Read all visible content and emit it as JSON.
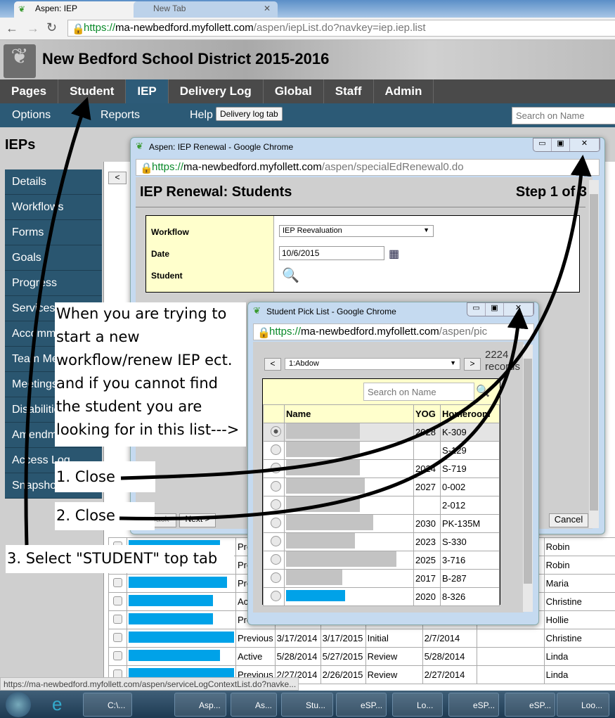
{
  "browser": {
    "tabs": [
      {
        "label": "Aspen: IEP"
      },
      {
        "label": "New Tab"
      }
    ],
    "url": {
      "scheme": "https://",
      "host": "ma-newbedford.myfollett.com",
      "path": "/aspen/iepList.do?navkey=iep.iep.list"
    },
    "status_url": "https://ma-newbedford.myfollett.com/aspen/serviceLogContextList.do?navke..."
  },
  "app": {
    "title": "New Bedford School District 2015-2016",
    "top_tabs": [
      "Pages",
      "Student",
      "IEP",
      "Delivery Log",
      "Global",
      "Staff",
      "Admin"
    ],
    "active_tab": "IEP",
    "sub_nav": [
      "Options",
      "Reports",
      "Help"
    ],
    "tooltip": "Delivery log tab",
    "search_placeholder": "Search on Name",
    "page_title": "IEPs",
    "side_items": [
      "Details",
      "Workflows",
      "Forms",
      "Goals",
      "Progress",
      "Services",
      "Accommodations",
      "Team Members",
      "Meetings",
      "Disabilities",
      "Amendments",
      "Access Log",
      "Snapshots"
    ],
    "prev_button": "<",
    "rows": [
      {
        "status": "Pre",
        "d1": "",
        "d2": "",
        "type": "",
        "d3": "",
        "staff": "Robin"
      },
      {
        "status": "Pre",
        "d1": "",
        "d2": "",
        "type": "",
        "d3": "",
        "staff": "Robin"
      },
      {
        "status": "Pre",
        "d1": "",
        "d2": "",
        "type": "",
        "d3": "",
        "staff": "Maria"
      },
      {
        "status": "Act",
        "d1": "",
        "d2": "",
        "type": "",
        "d3": "",
        "staff": "Christine"
      },
      {
        "status": "Pre",
        "d1": "",
        "d2": "",
        "type": "",
        "d3": "",
        "staff": "Hollie"
      },
      {
        "status": "Previous",
        "d1": "3/17/2014",
        "d2": "3/17/2015",
        "type": "Initial",
        "d3": "2/7/2014",
        "staff": "Christine"
      },
      {
        "status": "Active",
        "d1": "5/28/2014",
        "d2": "5/27/2015",
        "type": "Review",
        "d3": "5/28/2014",
        "staff": "Linda"
      },
      {
        "status": "Previous",
        "d1": "2/27/2014",
        "d2": "2/26/2015",
        "type": "Review",
        "d3": "2/27/2014",
        "staff": "Linda"
      }
    ]
  },
  "renewal": {
    "window_title": "Aspen: IEP Renewal - Google Chrome",
    "url": {
      "scheme": "https://",
      "host": "ma-newbedford.myfollett.com",
      "path": "/aspen/specialEdRenewal0.do"
    },
    "heading": "IEP Renewal: Students",
    "step": "Step 1 of 3",
    "workflow_label": "Workflow",
    "workflow_value": "IEP Reevaluation",
    "date_label": "Date",
    "date_value": "10/6/2015",
    "student_label": "Student",
    "back": "< Back",
    "next": "Next >",
    "cancel": "Cancel"
  },
  "picklist": {
    "window_title": "Student Pick List - Google Chrome",
    "url": {
      "scheme": "https://",
      "host": "ma-newbedford.myfollett.com",
      "path": "/aspen/pic"
    },
    "selector_value": "1:Abdow",
    "records": "2224 records",
    "search_placeholder": "Search on Name",
    "columns": [
      "Name",
      "YOG",
      "Homeroom"
    ],
    "rows": [
      {
        "yog": "2028",
        "hr": "K-309"
      },
      {
        "yog": "",
        "hr": "S-129"
      },
      {
        "yog": "2024",
        "hr": "S-719"
      },
      {
        "yog": "2027",
        "hr": "0-002"
      },
      {
        "yog": "",
        "hr": "2-012"
      },
      {
        "yog": "2030",
        "hr": "PK-135M"
      },
      {
        "yog": "2023",
        "hr": "S-330"
      },
      {
        "yog": "2025",
        "hr": "3-716"
      },
      {
        "yog": "2017",
        "hr": "B-287"
      },
      {
        "yog": "2020",
        "hr": "8-326"
      }
    ]
  },
  "annotations": {
    "intro": "When you are trying to start a new workflow/renew IEP ect. and if you cannot find the student you are looking for in this list--->",
    "step1": "1. Close",
    "step2": "2. Close",
    "step3": "3. Select \"STUDENT\" top tab"
  },
  "taskbar": [
    "C:\\...",
    "Asp...",
    "As...",
    "Stu...",
    "eSP...",
    "Lo...",
    "eSP...",
    "eSP...",
    "Loo..."
  ]
}
